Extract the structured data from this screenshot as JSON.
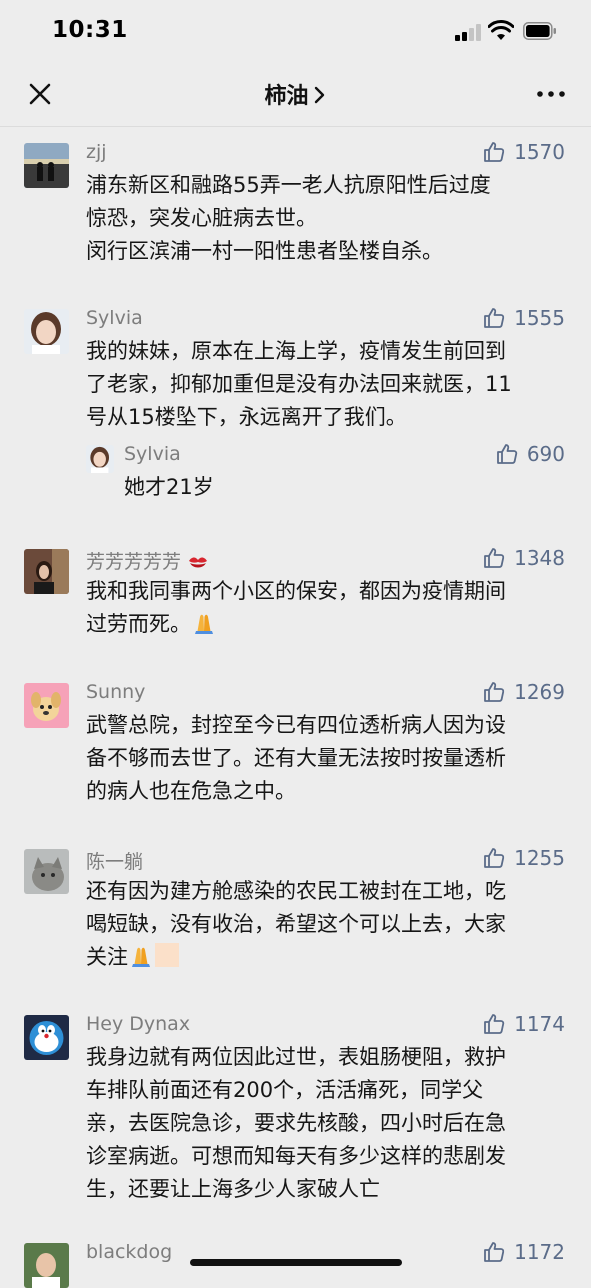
{
  "status_bar": {
    "time": "10:31"
  },
  "nav": {
    "title": "柿油"
  },
  "comments": [
    {
      "nick": "zjj",
      "likes": "1570",
      "text": "浦东新区和融路55弄一老人抗原阳性后过度\n惊恐，突发心脏病去世。\n闵行区滨浦一村一阳性患者坠楼自杀。"
    },
    {
      "nick": "Sylvia",
      "likes": "1555",
      "text": "我的妹妹，原本在上海上学，疫情发生前回到\n了老家，抑郁加重但是没有办法回来就医，11\n号从15楼坠下，永远离开了我们。",
      "reply": {
        "nick": "Sylvia",
        "likes": "690",
        "text": "她才21岁"
      }
    },
    {
      "nick": "芳芳芳芳芳",
      "likes": "1348",
      "text": "我和我同事两个小区的保安，都因为疫情期间\n过劳而死。"
    },
    {
      "nick": "Sunny",
      "likes": "1269",
      "text": "武警总院，封控至今已有四位透析病人因为设\n备不够而去世了。还有大量无法按时按量透析\n的病人也在危急之中。"
    },
    {
      "nick": "陈一躺",
      "likes": "1255",
      "text": "还有因为建方舱感染的农民工被封在工地，吃\n喝短缺，没有收治，希望这个可以上去，大家\n关注"
    },
    {
      "nick": "Hey Dynax",
      "likes": "1174",
      "text": "我身边就有两位因此过世，表姐肠梗阻，救护\n车排队前面还有200个，活活痛死，同学父\n亲，去医院急诊，要求先核酸，四小时后在急\n诊室病逝。可想而知每天有多少这样的悲剧发\n生，还要让上海多少人家破人亡"
    },
    {
      "nick": "blackdog",
      "likes": "1172",
      "text": ""
    }
  ],
  "colors": {
    "background": "#ededed",
    "nickname": "#7d7d7d",
    "likes": "#5b6c89",
    "text": "#161616"
  },
  "icons": {
    "close": "close-icon",
    "more": "more-icon",
    "like": "thumbs-up-icon"
  }
}
